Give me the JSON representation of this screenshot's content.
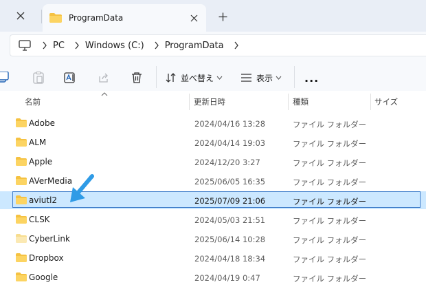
{
  "tabs": [
    {
      "title": "ProgramData",
      "active": true
    }
  ],
  "breadcrumb": [
    "PC",
    "Windows (C:)",
    "ProgramData"
  ],
  "toolbar": {
    "sort_label": "並べ替え",
    "view_label": "表示",
    "more_label": "..."
  },
  "columns": [
    "名前",
    "更新日時",
    "種類",
    "サイズ"
  ],
  "files": [
    {
      "name": "Adobe",
      "modified": "2024/04/16 13:28",
      "type": "ファイル フォルダー"
    },
    {
      "name": "ALM",
      "modified": "2024/04/14 19:03",
      "type": "ファイル フォルダー"
    },
    {
      "name": "Apple",
      "modified": "2024/12/20 3:27",
      "type": "ファイル フォルダー"
    },
    {
      "name": "AVerMedia",
      "modified": "2025/06/05 16:35",
      "type": "ファイル フォルダー"
    },
    {
      "name": "aviutl2",
      "modified": "2025/07/09 21:06",
      "type": "ファイル フォルダー",
      "selected": true
    },
    {
      "name": "CLSK",
      "modified": "2024/05/03 21:51",
      "type": "ファイル フォルダー"
    },
    {
      "name": "CyberLink",
      "modified": "2025/06/14 10:28",
      "type": "ファイル フォルダー"
    },
    {
      "name": "Dropbox",
      "modified": "2024/04/18 18:34",
      "type": "ファイル フォルダー"
    },
    {
      "name": "Google",
      "modified": "2024/04/19 0:47",
      "type": "ファイル フォルダー"
    }
  ],
  "colors": {
    "accent_arrow": "#2f9be6",
    "selection_bg": "#cce8ff",
    "selection_border": "#3d7cc9",
    "folder": "#f5c242"
  },
  "icons": [
    "close-icon",
    "folder-icon",
    "plus-icon",
    "computer-icon",
    "chevron-right-icon",
    "copy-icon",
    "paste-icon",
    "rename-icon",
    "share-icon",
    "delete-icon",
    "sort-icon",
    "view-icon",
    "chevron-down-icon",
    "more-icon",
    "sort-up-icon",
    "pointer-arrow-icon"
  ]
}
